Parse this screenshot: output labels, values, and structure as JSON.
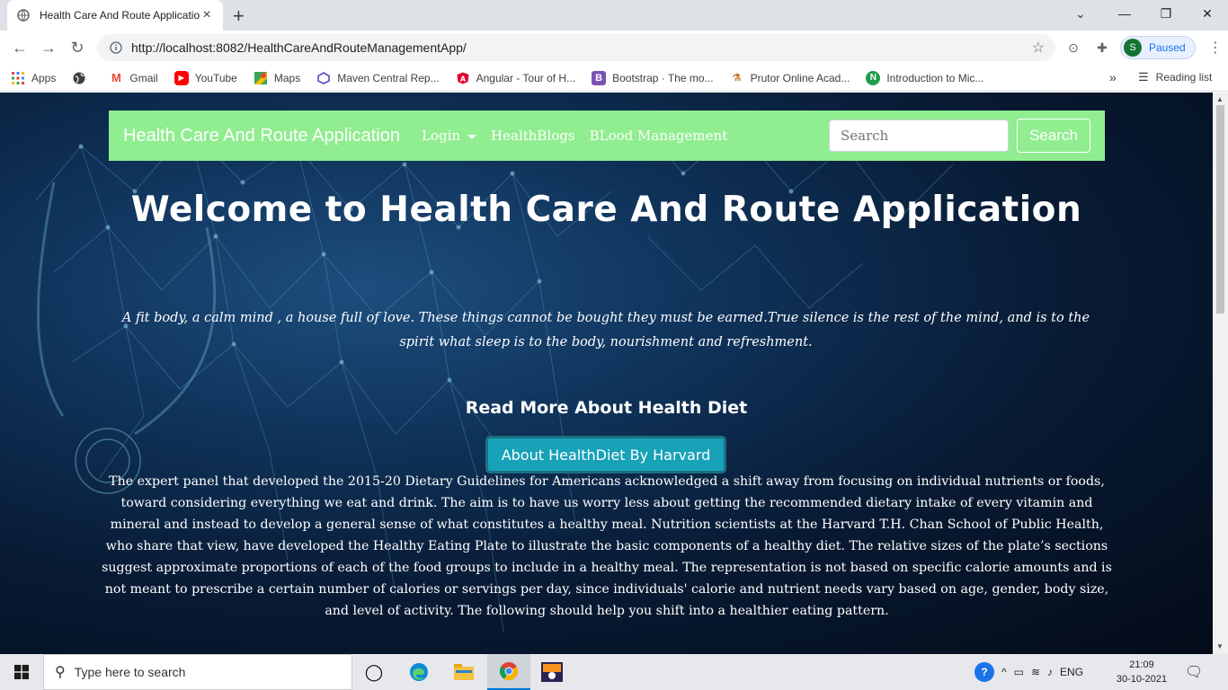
{
  "browser": {
    "tab_title": "Health Care And Route Applicatio",
    "url": "http://localhost:8082/HealthCareAndRouteManagementApp/",
    "profile_initial": "S",
    "profile_status": "Paused"
  },
  "bookmarks": {
    "items": [
      {
        "label": "Apps",
        "icon": "apps-grid-icon"
      },
      {
        "label": "",
        "icon": "globe-icon"
      },
      {
        "label": "Gmail",
        "icon": "gmail-icon"
      },
      {
        "label": "YouTube",
        "icon": "youtube-icon"
      },
      {
        "label": "Maps",
        "icon": "maps-icon"
      },
      {
        "label": "Maven Central Rep...",
        "icon": "maven-icon"
      },
      {
        "label": "Angular - Tour of H...",
        "icon": "angular-icon"
      },
      {
        "label": "Bootstrap · The mo...",
        "icon": "bootstrap-icon"
      },
      {
        "label": "Prutor Online Acad...",
        "icon": "prutor-icon"
      },
      {
        "label": "Introduction to Mic...",
        "icon": "n-icon"
      }
    ],
    "more": "»",
    "reading_list": "Reading list"
  },
  "navbar": {
    "brand": "Health Care And Route Application",
    "login": "Login",
    "blogs": "HealthBlogs",
    "blood": "BLood Management",
    "search_placeholder": "Search",
    "search_button": "Search"
  },
  "main": {
    "title": "Welcome to Health Care And Route Application",
    "quote": "A fit body, a calm mind , a house full of love. These things cannot be bought they must be earned.True silence is the rest of the mind, and is to the spirit what sleep is to the body, nourishment and refreshment.",
    "subheading": "Read More About Health Diet",
    "harvard_button": "About HealthDiet By Harvard",
    "body_text": "The expert panel that developed the 2015-20 Dietary Guidelines for Americans acknowledged a shift away from focusing on individual nutrients or foods, toward considering everything we eat and drink. The aim is to have us worry less about getting the recommended dietary intake of every vitamin and mineral and instead to develop a general sense of what constitutes a healthy meal. Nutrition scientists at the Harvard T.H. Chan School of Public Health, who share that view, have developed the Healthy Eating Plate to illustrate the basic components of a healthy diet. The relative sizes of the plate’s sections suggest approximate proportions of each of the food groups to include in a healthy meal. The representation is not based on specific calorie amounts and is not meant to prescribe a certain number of calories or servings per day, since individuals' calorie and nutrient needs vary based on age, gender, body size, and level of activity. The following should help you shift into a healthier eating pattern."
  },
  "taskbar": {
    "search_placeholder": "Type here to search",
    "language": "ENG",
    "time": "21:09",
    "date": "30-10-2021"
  },
  "colors": {
    "navbar_bg": "#90ee90",
    "button_bg": "#17a2b8",
    "page_bg": "#081a33"
  }
}
